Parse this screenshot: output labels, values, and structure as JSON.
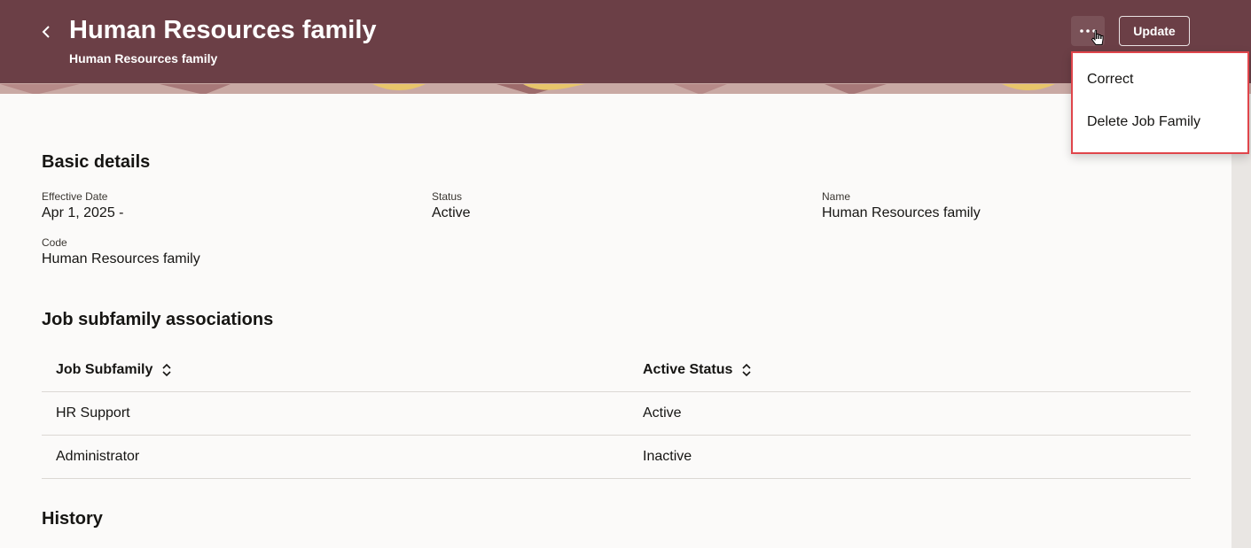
{
  "header": {
    "title": "Human Resources family",
    "subtitle": "Human Resources family",
    "update_label": "Update",
    "back_icon": "chevron-left-icon",
    "more_icon": "ellipsis-icon",
    "background_color": "#6b3f46"
  },
  "menu": {
    "items": [
      {
        "label": "Correct"
      },
      {
        "label": "Delete Job Family"
      }
    ],
    "highlight_color": "#e0454b"
  },
  "basic_details": {
    "title": "Basic details",
    "effective_date": {
      "label": "Effective Date",
      "value": "Apr 1, 2025 -"
    },
    "status": {
      "label": "Status",
      "value": "Active"
    },
    "name": {
      "label": "Name",
      "value": "Human Resources family"
    },
    "code": {
      "label": "Code",
      "value": "Human Resources family"
    }
  },
  "subfamily": {
    "title": "Job subfamily associations",
    "columns": [
      "Job Subfamily",
      "Active Status"
    ],
    "rows": [
      [
        "HR Support",
        "Active"
      ],
      [
        "Administrator",
        "Inactive"
      ]
    ]
  },
  "history": {
    "title": "History"
  }
}
